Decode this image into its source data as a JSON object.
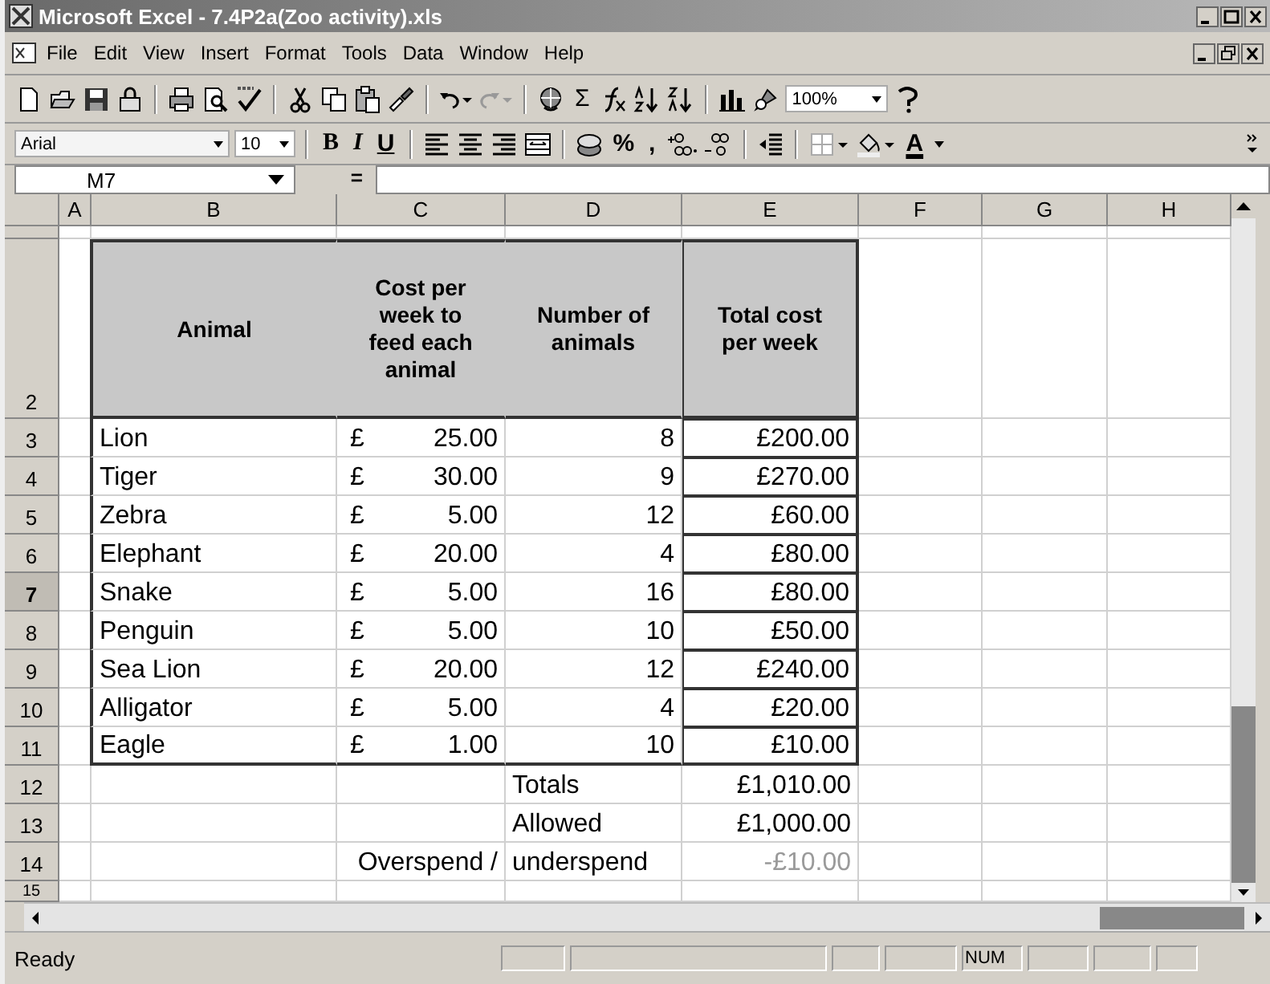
{
  "window": {
    "title": "Microsoft Excel - 7.4P2a(Zoo activity).xls"
  },
  "menu": [
    "File",
    "Edit",
    "View",
    "Insert",
    "Format",
    "Tools",
    "Data",
    "Window",
    "Help"
  ],
  "standard_toolbar": {
    "sum": "Σ",
    "zoom": "100%"
  },
  "formatting_toolbar": {
    "font": "Arial",
    "size": "10",
    "bold": "B",
    "italic": "I",
    "underline": "U",
    "percent": "%",
    "comma": ",",
    "font_color": "A"
  },
  "formula_bar": {
    "name_box": "M7",
    "equals": "="
  },
  "columns": [
    {
      "label": "A"
    },
    {
      "label": "B"
    },
    {
      "label": "C"
    },
    {
      "label": "D"
    },
    {
      "label": "E"
    },
    {
      "label": "F"
    },
    {
      "label": "G"
    },
    {
      "label": "H"
    }
  ],
  "rows": [
    {
      "kind": "blank",
      "selected": false
    },
    {
      "number": "2",
      "kind": "header",
      "selected": false,
      "animal": "Animal",
      "cost": "Cost per week to feed each animal",
      "count": "Number of animals",
      "total": "Total cost per week"
    },
    {
      "number": "3",
      "kind": "data",
      "selected": false,
      "animal": "Lion",
      "currency": "£",
      "cost": "25.00",
      "count": "8",
      "total": "£200.00"
    },
    {
      "number": "4",
      "kind": "data",
      "selected": false,
      "animal": "Tiger",
      "currency": "£",
      "cost": "30.00",
      "count": "9",
      "total": "£270.00"
    },
    {
      "number": "5",
      "kind": "data",
      "selected": false,
      "animal": "Zebra",
      "currency": "£",
      "cost": "5.00",
      "count": "12",
      "total": "£60.00"
    },
    {
      "number": "6",
      "kind": "data",
      "selected": false,
      "animal": "Elephant",
      "currency": "£",
      "cost": "20.00",
      "count": "4",
      "total": "£80.00"
    },
    {
      "number": "7",
      "kind": "data",
      "selected": true,
      "animal": "Snake",
      "currency": "£",
      "cost": "5.00",
      "count": "16",
      "total": "£80.00"
    },
    {
      "number": "8",
      "kind": "data",
      "selected": false,
      "animal": "Penguin",
      "currency": "£",
      "cost": "5.00",
      "count": "10",
      "total": "£50.00"
    },
    {
      "number": "9",
      "kind": "data",
      "selected": false,
      "animal": "Sea Lion",
      "currency": "£",
      "cost": "20.00",
      "count": "12",
      "total": "£240.00"
    },
    {
      "number": "10",
      "kind": "data",
      "selected": false,
      "animal": "Alligator",
      "currency": "£",
      "cost": "5.00",
      "count": "4",
      "total": "£20.00"
    },
    {
      "number": "11",
      "kind": "data",
      "selected": false,
      "animal": "Eagle",
      "currency": "£",
      "cost": "1.00",
      "count": "10",
      "total": "£10.00"
    },
    {
      "number": "12",
      "kind": "summary",
      "selected": false,
      "label": "Totals",
      "value": "£1,010.00",
      "negative": false
    },
    {
      "number": "13",
      "kind": "summary",
      "selected": false,
      "label": "Allowed",
      "value": "£1,000.00",
      "negative": false
    },
    {
      "number": "14",
      "kind": "summary",
      "selected": false,
      "label_c": "Overspend /",
      "label": "underspend",
      "value": "-£10.00",
      "negative": true
    },
    {
      "number": "15",
      "kind": "blank",
      "selected": false
    }
  ],
  "status_bar": {
    "status": "Ready",
    "indicator": "NUM"
  }
}
